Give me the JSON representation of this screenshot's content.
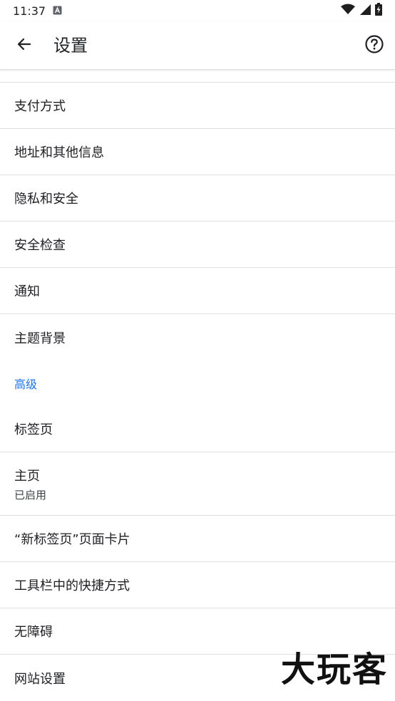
{
  "status_bar": {
    "time": "11:37",
    "notification_icon": "a-box-icon",
    "icons": [
      "wifi-icon",
      "signal-icon",
      "battery-charging-icon"
    ]
  },
  "app_bar": {
    "title": "设置",
    "back_icon": "arrow-left-icon",
    "help_icon": "help-circle-icon"
  },
  "settings": {
    "items": [
      {
        "label": "支付方式"
      },
      {
        "label": "地址和其他信息"
      },
      {
        "label": "隐私和安全"
      },
      {
        "label": "安全检查"
      },
      {
        "label": "通知"
      },
      {
        "label": "主题背景"
      }
    ],
    "advanced_header": "高级",
    "advanced_items": [
      {
        "label": "标签页"
      },
      {
        "label": "主页",
        "sub": "已启用"
      },
      {
        "label": "“新标签页”页面卡片"
      },
      {
        "label": "工具栏中的快捷方式"
      },
      {
        "label": "无障碍"
      },
      {
        "label": "网站设置"
      }
    ]
  },
  "watermark": "大玩客",
  "colors": {
    "accent": "#1a73e8",
    "divider": "#e0e0e0",
    "text": "#202124"
  }
}
